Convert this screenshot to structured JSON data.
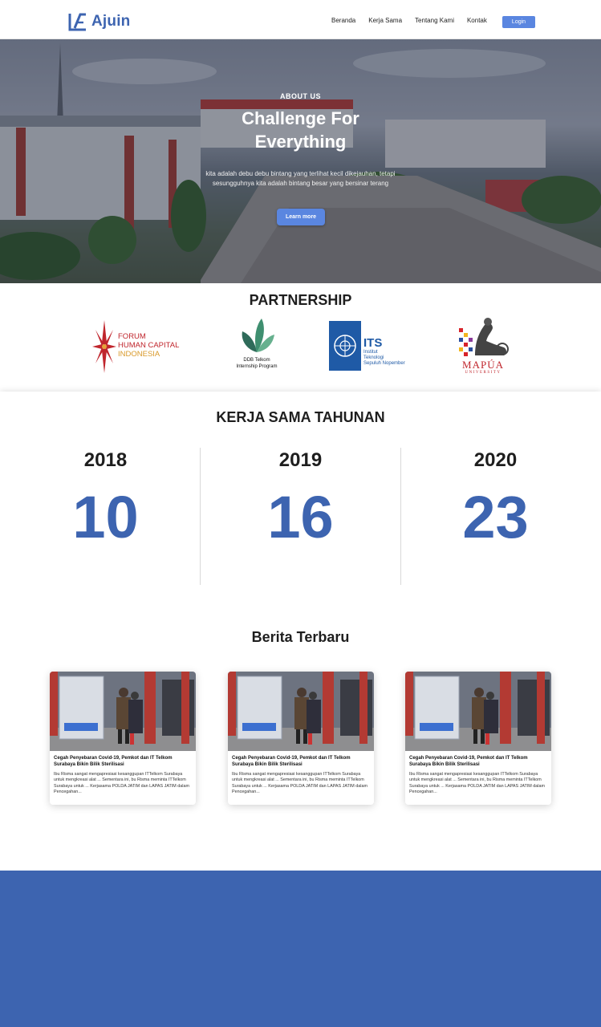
{
  "brand": {
    "name": "Ajuin",
    "color": "#3d64b0"
  },
  "nav": {
    "items": [
      "Beranda",
      "Kerja Sama",
      "Tentang Kami",
      "Kontak"
    ],
    "login_label": "Login"
  },
  "hero": {
    "eyebrow": "ABOUT US",
    "headline_line1": "Challenge For",
    "headline_line2": "Everything",
    "tagline": "kita adalah debu debu bintang yang terlihat kecil dikejauhan, tetapi sesungguhnya kita adalah bintang besar yang bersinar terang",
    "cta_label": "Learn more"
  },
  "partnership": {
    "title": "PARTNERSHIP",
    "partners": [
      {
        "name": "forum-human-capital-indonesia",
        "lines": [
          "FORUM",
          "HUMAN CAPITAL",
          "INDONESIA"
        ]
      },
      {
        "name": "ddb-telkom",
        "lines": [
          "DDB Telkom",
          "Internship Program"
        ]
      },
      {
        "name": "its",
        "lines": [
          "ITS",
          "Institut",
          "Teknologi",
          "Sepuluh Nopember"
        ]
      },
      {
        "name": "mapua",
        "lines": [
          "MAPÚA",
          "UNIVERSITY"
        ]
      }
    ]
  },
  "kerja_sama": {
    "title": "KERJA SAMA TAHUNAN",
    "years": [
      {
        "year": "2018",
        "value": "10"
      },
      {
        "year": "2019",
        "value": "16"
      },
      {
        "year": "2020",
        "value": "23"
      }
    ]
  },
  "berita": {
    "title": "Berita Terbaru",
    "cards": [
      {
        "title": "Cegah Penyebaran Covid-19, Pemkot dan IT Telkom Surabaya Bikin Bilik Sterilisasi",
        "excerpt": "Ibu Risma sangat mengapresiasi kesanggupan ITTelkom Surabaya untuk mengkreasi alat ... Sementara ini, bu Risma meminta ITTelkom Surabaya untuk ... Kerjasama POLDA JATIM dan LAPAS JATIM dalam Pencegahan..."
      },
      {
        "title": "Cegah Penyebaran Covid-19, Pemkot dan IT Telkom Surabaya Bikin Bilik Sterilisasi",
        "excerpt": "Ibu Risma sangat mengapresiasi kesanggupan ITTelkom Surabaya untuk mengkreasi alat ... Sementara ini, bu Risma meminta ITTelkom Surabaya untuk ... Kerjasama POLDA JATIM dan LAPAS JATIM dalam Pencegahan..."
      },
      {
        "title": "Cegah Penyebaran Covid-19, Pemkot dan IT Telkom Surabaya Bikin Bilik Sterilisasi",
        "excerpt": "Ibu Risma sangat mengapresiasi kesanggupan ITTelkom Surabaya untuk mengkreasi alat ... Sementara ini, bu Risma meminta ITTelkom Surabaya untuk ... Kerjasama POLDA JATIM dan LAPAS JATIM dalam Pencegahan..."
      }
    ]
  },
  "colors": {
    "accent": "#3d64b0",
    "button": "#5a86e0",
    "footer": "#3d64b0"
  }
}
